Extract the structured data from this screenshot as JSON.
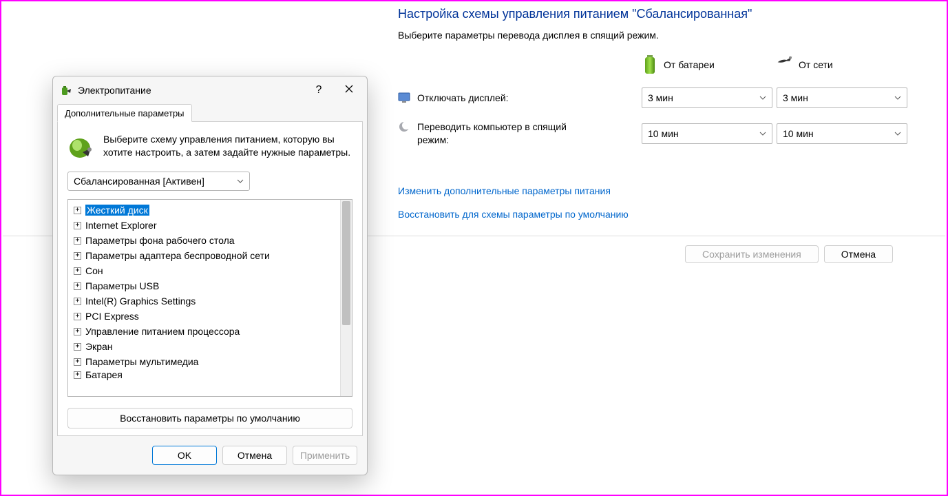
{
  "bg": {
    "title": "Настройка схемы управления питанием \"Сбалансированная\"",
    "subtitle": "Выберите параметры перевода дисплея в спящий режим.",
    "col_battery": "От батареи",
    "col_mains": "От сети",
    "row_display": "Отключать дисплей:",
    "row_sleep": "Переводить компьютер в спящий режим:",
    "val_display_battery": "3 мин",
    "val_display_mains": "3 мин",
    "val_sleep_battery": "10 мин",
    "val_sleep_mains": "10 мин",
    "link_advanced": "Изменить дополнительные параметры питания",
    "link_restore": "Восстановить для схемы параметры по умолчанию",
    "btn_save": "Сохранить изменения",
    "btn_cancel": "Отмена"
  },
  "dialog": {
    "title": "Электропитание",
    "tab": "Дополнительные параметры",
    "desc": "Выберите схему управления питанием, которую вы хотите настроить, а затем задайте нужные параметры.",
    "plan_selected": "Сбалансированная [Активен]",
    "tree": [
      "Жесткий диск",
      "Internet Explorer",
      "Параметры фона рабочего стола",
      "Параметры адаптера беспроводной сети",
      "Сон",
      "Параметры USB",
      "Intel(R) Graphics Settings",
      "PCI Express",
      "Управление питанием процессора",
      "Экран",
      "Параметры мультимедиа",
      "Батарея"
    ],
    "restore_defaults": "Восстановить параметры по умолчанию",
    "btn_ok": "OK",
    "btn_cancel": "Отмена",
    "btn_apply": "Применить"
  }
}
